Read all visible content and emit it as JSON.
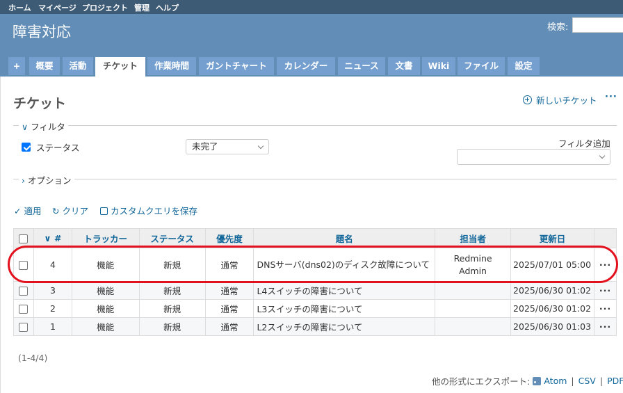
{
  "top_menu": [
    "ホーム",
    "マイページ",
    "プロジェクト",
    "管理",
    "ヘルプ"
  ],
  "header": {
    "project_title": "障害対応",
    "search_label": "検索:"
  },
  "tabs": [
    {
      "label": "+"
    },
    {
      "label": "概要"
    },
    {
      "label": "活動"
    },
    {
      "label": "チケット",
      "selected": true
    },
    {
      "label": "作業時間"
    },
    {
      "label": "ガントチャート"
    },
    {
      "label": "カレンダー"
    },
    {
      "label": "ニュース"
    },
    {
      "label": "文書"
    },
    {
      "label": "Wiki"
    },
    {
      "label": "ファイル"
    },
    {
      "label": "設定"
    }
  ],
  "page": {
    "title": "チケット",
    "new_issue": "新しいチケット",
    "more": "···"
  },
  "filters": {
    "legend": "フィルタ",
    "status_label": "ステータス",
    "status_checked": true,
    "status_value": "未完了",
    "add_filter_label": "フィルタ追加",
    "add_filter_value": ""
  },
  "options": {
    "legend": "オプション"
  },
  "actions": {
    "apply": "適用",
    "clear": "クリア",
    "save": "カスタムクエリを保存"
  },
  "table": {
    "headers": {
      "id": "#",
      "tracker": "トラッカー",
      "status": "ステータス",
      "priority": "優先度",
      "subject": "題名",
      "assignee": "担当者",
      "updated": "更新日"
    },
    "rows": [
      {
        "id": "4",
        "tracker": "機能",
        "status": "新規",
        "priority": "通常",
        "subject": "DNSサーバ(dns02)のディスク故障について",
        "assignee": "Redmine Admin",
        "updated": "2025/07/01 05:00",
        "more": "···"
      },
      {
        "id": "3",
        "tracker": "機能",
        "status": "新規",
        "priority": "通常",
        "subject": "L4スイッチの障害について",
        "assignee": "",
        "updated": "2025/06/30 01:02",
        "more": "···"
      },
      {
        "id": "2",
        "tracker": "機能",
        "status": "新規",
        "priority": "通常",
        "subject": "L3スイッチの障害について",
        "assignee": "",
        "updated": "2025/06/30 01:02",
        "more": "···"
      },
      {
        "id": "1",
        "tracker": "機能",
        "status": "新規",
        "priority": "通常",
        "subject": "L2スイッチの障害について",
        "assignee": "",
        "updated": "2025/06/30 01:03",
        "more": "···"
      }
    ]
  },
  "pagination": "(1-4/4)",
  "export": {
    "label": "他の形式にエクスポート:",
    "atom": "Atom",
    "csv": "CSV",
    "pdf": "PDF",
    "sep": "|"
  },
  "colors": {
    "header": "#628db6",
    "top_menu": "#3e5b76",
    "tab": "#759fcf",
    "link": "#116699",
    "highlight": "#e3101d"
  }
}
